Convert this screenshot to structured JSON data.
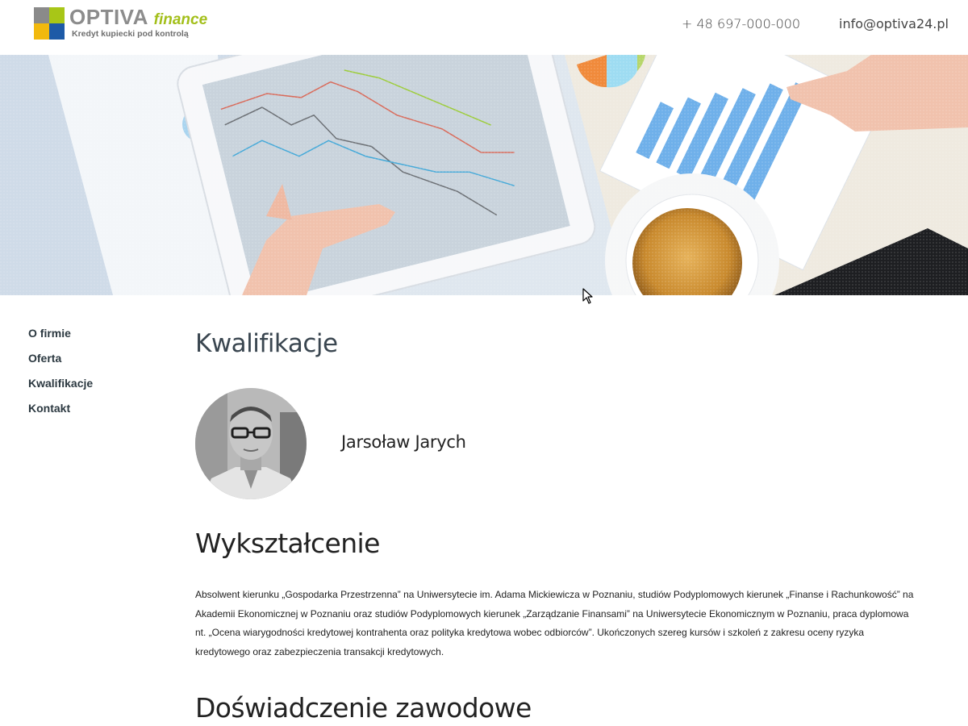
{
  "header": {
    "logo": {
      "name_main": "OPTIVA",
      "name_accent": "finance",
      "tagline": "Kredyt kupiecki pod kontrolą"
    },
    "phone": "+ 48 697-000-000",
    "email": "info@optiva24.pl"
  },
  "sidebar": {
    "items": [
      {
        "label": "O firmie"
      },
      {
        "label": "Oferta"
      },
      {
        "label": "Kwalifikacje"
      },
      {
        "label": "Kontakt"
      }
    ]
  },
  "main": {
    "title": "Kwalifikacje",
    "person": {
      "name": "Jarsoław Jarych"
    },
    "education": {
      "heading": "Wykształcenie",
      "text": "Absolwent kierunku „Gospodarka Przestrzenna” na Uniwersytecie im. Adama Mickiewicza w Poznaniu, studiów Podyplomowych kierunek „Finanse i Rachunkowość” na Akademii Ekonomicznej w Poznaniu oraz studiów Podyplomowych kierunek „Zarządzanie Finansami” na Uniwersytecie Ekonomicznym w Poznaniu, praca dyplomowa nt. „Ocena wiarygodności kredytowej kontrahenta oraz polityka kredytowa wobec odbiorców”. Ukończonych szereg kursów i szkoleń z zakresu oceny ryzyka kredytowego oraz zabezpieczenia transakcji kredytowych."
    },
    "experience": {
      "heading": "Doświadczenie zawodowe"
    }
  },
  "colors": {
    "logo_gray": "#8c8c8c",
    "logo_green": "#a3bf1a",
    "logo_yellow": "#f2b90d",
    "logo_blue": "#1d5aa7",
    "nav_text": "#2b3840"
  }
}
